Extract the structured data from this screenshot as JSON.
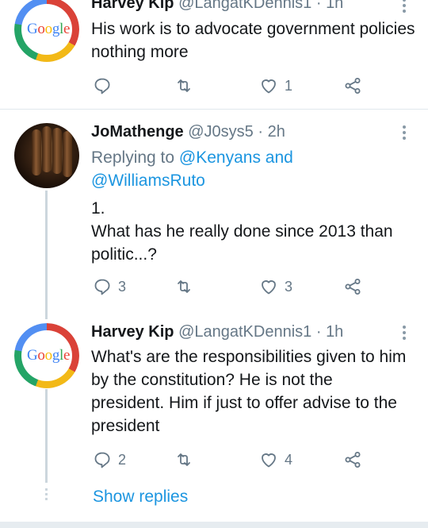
{
  "tweets": [
    {
      "name": "Harvey Kip",
      "handle": "@LangatKDennis1",
      "dot": "·",
      "time": "1h",
      "text": "His work is to advocate government policies nothing more",
      "avatar_text": [
        "G",
        "o",
        "o",
        "g",
        "l",
        "e"
      ],
      "reply_count": "",
      "retweet_count": "",
      "like_count": "1"
    },
    {
      "name": "JoMathenge",
      "handle": "@J0sys5",
      "dot": "·",
      "time": "2h",
      "replying_prefix": "Replying to",
      "replying_to": "@Kenyans and @WilliamsRuto",
      "text_line1": "1.",
      "text_line2": "What has he really done since 2013 than politic...?",
      "reply_count": "3",
      "retweet_count": "",
      "like_count": "3"
    },
    {
      "name": "Harvey Kip",
      "handle": "@LangatKDennis1",
      "dot": "·",
      "time": "1h",
      "text": "What's are the responsibilities given to him by the constitution? He is not the president. Him if just to offer advise to the president",
      "avatar_text": [
        "G",
        "o",
        "o",
        "g",
        "l",
        "e"
      ],
      "reply_count": "2",
      "retweet_count": "",
      "like_count": "4"
    }
  ],
  "show_replies": "Show replies",
  "colors": {
    "link": "#1b95e0",
    "secondary": "#657786",
    "divider": "#e1e8ed"
  },
  "icons": [
    "reply-icon",
    "retweet-icon",
    "like-icon",
    "share-icon",
    "more-icon"
  ]
}
